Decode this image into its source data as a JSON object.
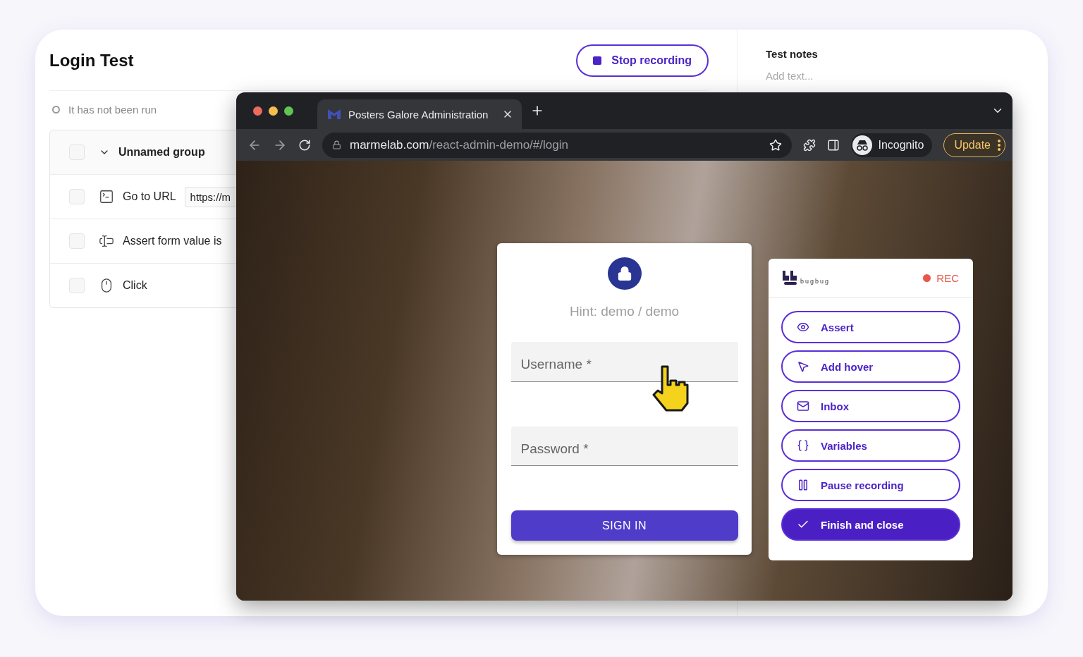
{
  "test": {
    "title": "Login Test",
    "status": "It has not been run"
  },
  "stop_button": {
    "label": "Stop recording"
  },
  "steps": [
    {
      "kind": "group",
      "label": "Unnamed group",
      "checked": false,
      "expanded": true,
      "children": [
        {
          "kind": "goto",
          "label": "Go to URL",
          "value": "https://m",
          "checked": false
        },
        {
          "kind": "assert",
          "label": "Assert form value is",
          "checked": false
        },
        {
          "kind": "click",
          "label": "Click",
          "checked": false
        }
      ]
    }
  ],
  "notes": {
    "title": "Test notes",
    "placeholder": "Add text..."
  },
  "browser": {
    "tab": {
      "title": "Posters Galore Administration"
    },
    "url": {
      "domain": "marmelab.com",
      "path": "/react-admin-demo/#/login"
    },
    "profile": "Incognito",
    "update": "Update"
  },
  "login": {
    "hint": "Hint: demo / demo",
    "fields": [
      {
        "placeholder": "Username *"
      },
      {
        "placeholder": "Password *"
      }
    ],
    "button": "SIGN IN"
  },
  "recorder": {
    "logo": "bugbug",
    "status": "REC",
    "actions": [
      {
        "kind": "assert",
        "label": "Assert",
        "primary": false
      },
      {
        "kind": "hover",
        "label": "Add hover",
        "primary": false
      },
      {
        "kind": "inbox",
        "label": "Inbox",
        "primary": false
      },
      {
        "kind": "variables",
        "label": "Variables",
        "primary": false
      },
      {
        "kind": "pause",
        "label": "Pause recording",
        "primary": false
      },
      {
        "kind": "finish",
        "label": "Finish and close",
        "primary": true
      }
    ]
  }
}
